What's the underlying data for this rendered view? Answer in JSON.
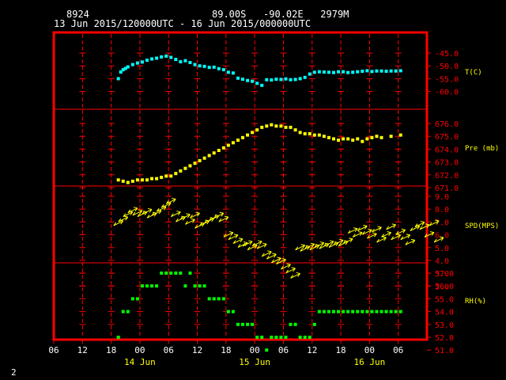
{
  "header": {
    "station": "8924",
    "location": "89.00S   -90.02E   2979M",
    "time_range": "13 Jun 2015/120000UTC - 16 Jun 2015/000000UTC"
  },
  "corner_label": "2",
  "colors": {
    "frame": "#ff0000",
    "grid": "#ff0000",
    "tick_label": "#ff0000",
    "axis_label": "#ffff00",
    "temperature": "#00ffff",
    "pressure": "#ffff00",
    "wind": "#ffff00",
    "rh": "#00ff00"
  },
  "chart_data": {
    "type": "scatter",
    "x_axis": {
      "hour_labels": [
        "06",
        "12",
        "18",
        "00",
        "06",
        "12",
        "18",
        "00",
        "06",
        "12",
        "18",
        "00",
        "06"
      ],
      "day_labels": [
        "14 Jun",
        "15 Jun",
        "16 Jun"
      ]
    },
    "panels": [
      {
        "name": "temperature",
        "label": "T(C)",
        "ticks": [
          "-45.0",
          "-50.0",
          "-55.0",
          "-60.0"
        ],
        "ylim": [
          -60,
          -45
        ],
        "unit_per_tick": 5,
        "points": [
          [
            13.5,
            -55.0
          ],
          [
            14.0,
            -52.4
          ],
          [
            14.5,
            -51.5
          ],
          [
            15.0,
            -51.0
          ],
          [
            15.5,
            -50.4
          ],
          [
            16.5,
            -49.5
          ],
          [
            17.5,
            -48.9
          ],
          [
            18.5,
            -48.5
          ],
          [
            19.5,
            -47.8
          ],
          [
            20.5,
            -47.3
          ],
          [
            21.5,
            -47.0
          ],
          [
            22.5,
            -46.5
          ],
          [
            23.5,
            -46.2
          ],
          [
            24.5,
            -46.7
          ],
          [
            25.5,
            -47.5
          ],
          [
            26.5,
            -48.4
          ],
          [
            27.5,
            -48.0
          ],
          [
            28.5,
            -48.7
          ],
          [
            29.5,
            -49.5
          ],
          [
            30.5,
            -50.0
          ],
          [
            31.5,
            -50.2
          ],
          [
            32.5,
            -50.6
          ],
          [
            33.5,
            -50.5
          ],
          [
            34.5,
            -51.1
          ],
          [
            35.5,
            -51.5
          ],
          [
            36.5,
            -52.5
          ],
          [
            37.5,
            -52.8
          ],
          [
            38.5,
            -54.8
          ],
          [
            39.5,
            -55.2
          ],
          [
            40.5,
            -55.7
          ],
          [
            41.5,
            -56.0
          ],
          [
            42.5,
            -56.8
          ],
          [
            43.5,
            -57.6
          ],
          [
            44.5,
            -55.4
          ],
          [
            45.5,
            -55.5
          ],
          [
            46.5,
            -55.2
          ],
          [
            47.5,
            -55.3
          ],
          [
            48.5,
            -55.1
          ],
          [
            49.5,
            -55.4
          ],
          [
            50.5,
            -55.3
          ],
          [
            51.5,
            -55.0
          ],
          [
            52.5,
            -54.5
          ],
          [
            53.5,
            -53.2
          ],
          [
            54.5,
            -52.5
          ],
          [
            55.5,
            -52.3
          ],
          [
            56.5,
            -52.4
          ],
          [
            57.5,
            -52.5
          ],
          [
            58.5,
            -52.6
          ],
          [
            59.5,
            -52.3
          ],
          [
            60.5,
            -52.3
          ],
          [
            61.5,
            -52.6
          ],
          [
            62.5,
            -52.5
          ],
          [
            63.5,
            -52.3
          ],
          [
            64.5,
            -52.1
          ],
          [
            65.5,
            -51.9
          ],
          [
            66.5,
            -52.2
          ],
          [
            67.5,
            -52.0
          ],
          [
            68.5,
            -52.0
          ],
          [
            69.5,
            -52.1
          ],
          [
            70.5,
            -52.0
          ],
          [
            71.5,
            -52.0
          ],
          [
            72.5,
            -51.9
          ]
        ]
      },
      {
        "name": "pressure",
        "label": "Pre (mb)",
        "ticks": [
          "676.0",
          "675.0",
          "674.0",
          "673.0",
          "672.0",
          "671.0"
        ],
        "ylim": [
          671,
          676
        ],
        "unit_per_tick": 1,
        "points": [
          [
            13.5,
            671.6
          ],
          [
            14.5,
            671.5
          ],
          [
            15.5,
            671.4
          ],
          [
            16.5,
            671.5
          ],
          [
            17.5,
            671.6
          ],
          [
            18.5,
            671.6
          ],
          [
            19.5,
            671.6
          ],
          [
            20.5,
            671.7
          ],
          [
            21.5,
            671.7
          ],
          [
            22.5,
            671.8
          ],
          [
            23.5,
            671.9
          ],
          [
            24.5,
            671.9
          ],
          [
            25.5,
            672.1
          ],
          [
            26.5,
            672.3
          ],
          [
            27.5,
            672.5
          ],
          [
            28.5,
            672.7
          ],
          [
            29.5,
            672.9
          ],
          [
            30.5,
            673.1
          ],
          [
            31.5,
            673.3
          ],
          [
            32.5,
            673.5
          ],
          [
            33.5,
            673.7
          ],
          [
            34.5,
            673.9
          ],
          [
            35.5,
            674.1
          ],
          [
            36.5,
            674.3
          ],
          [
            37.5,
            674.5
          ],
          [
            38.5,
            674.7
          ],
          [
            39.5,
            674.9
          ],
          [
            40.5,
            675.1
          ],
          [
            41.5,
            675.3
          ],
          [
            42.5,
            675.5
          ],
          [
            43.5,
            675.7
          ],
          [
            44.5,
            675.8
          ],
          [
            45.5,
            675.9
          ],
          [
            46.5,
            675.8
          ],
          [
            47.5,
            675.8
          ],
          [
            48.5,
            675.7
          ],
          [
            49.5,
            675.7
          ],
          [
            50.5,
            675.5
          ],
          [
            51.5,
            675.3
          ],
          [
            52.5,
            675.2
          ],
          [
            53.5,
            675.2
          ],
          [
            54.5,
            675.1
          ],
          [
            55.5,
            675.1
          ],
          [
            56.5,
            675.0
          ],
          [
            57.5,
            674.9
          ],
          [
            58.5,
            674.8
          ],
          [
            59.5,
            674.7
          ],
          [
            60.5,
            674.8
          ],
          [
            61.5,
            674.8
          ],
          [
            62.5,
            674.7
          ],
          [
            63.5,
            674.8
          ],
          [
            64.5,
            674.6
          ],
          [
            65.5,
            674.8
          ],
          [
            66.5,
            674.9
          ],
          [
            67.5,
            675.0
          ],
          [
            68.5,
            674.9
          ],
          [
            70.5,
            675.0
          ],
          [
            72.5,
            675.1
          ]
        ]
      },
      {
        "name": "wind",
        "label": "SPD(MPS)",
        "ticks": [
          "9.0",
          "8.0",
          "7.0",
          "6.0",
          "5.0",
          "4.0",
          "3.0",
          "2.0"
        ],
        "ylim": [
          2,
          9
        ],
        "unit_per_tick": 1,
        "points": [
          [
            13.5,
            6.9
          ],
          [
            14.5,
            7.2
          ],
          [
            15.5,
            7.6
          ],
          [
            16.5,
            7.9
          ],
          [
            17.5,
            7.7
          ],
          [
            18.5,
            7.6
          ],
          [
            19.5,
            7.8
          ],
          [
            20.5,
            7.5
          ],
          [
            21.5,
            7.7
          ],
          [
            22.5,
            8.0
          ],
          [
            23.5,
            8.3
          ],
          [
            24.5,
            8.6
          ],
          [
            25.5,
            7.6
          ],
          [
            26.5,
            7.2
          ],
          [
            27.5,
            7.4
          ],
          [
            28.5,
            7.0
          ],
          [
            29.5,
            7.5
          ],
          [
            30.5,
            6.7
          ],
          [
            31.5,
            6.9
          ],
          [
            32.5,
            7.1
          ],
          [
            33.5,
            7.3
          ],
          [
            34.5,
            7.5
          ],
          [
            35.5,
            7.2
          ],
          [
            36.5,
            6.0
          ],
          [
            37.5,
            5.8
          ],
          [
            38.5,
            5.5
          ],
          [
            39.5,
            5.2
          ],
          [
            40.5,
            5.3
          ],
          [
            41.5,
            5.0
          ],
          [
            42.5,
            5.3
          ],
          [
            43.5,
            5.1
          ],
          [
            44.5,
            4.5
          ],
          [
            45.5,
            4.3
          ],
          [
            46.5,
            4.0
          ],
          [
            47.5,
            3.9
          ],
          [
            48.5,
            3.5
          ],
          [
            49.5,
            3.2
          ],
          [
            50.5,
            2.8
          ],
          [
            51.5,
            5.0
          ],
          [
            52.5,
            4.9
          ],
          [
            53.5,
            5.1
          ],
          [
            54.5,
            5.0
          ],
          [
            55.5,
            5.2
          ],
          [
            56.5,
            5.1
          ],
          [
            57.5,
            5.3
          ],
          [
            58.5,
            5.2
          ],
          [
            59.5,
            5.4
          ],
          [
            60.5,
            5.3
          ],
          [
            61.5,
            5.5
          ],
          [
            62.5,
            6.3
          ],
          [
            63.5,
            6.0
          ],
          [
            64.5,
            6.5
          ],
          [
            65.5,
            6.2
          ],
          [
            66.5,
            5.9
          ],
          [
            67.5,
            6.4
          ],
          [
            68.5,
            5.6
          ],
          [
            69.5,
            6.0
          ],
          [
            70.5,
            6.6
          ],
          [
            71.5,
            5.8
          ],
          [
            72.5,
            6.2
          ],
          [
            73.5,
            5.8
          ],
          [
            74.5,
            5.4
          ],
          [
            75.5,
            6.5
          ],
          [
            76.5,
            6.8
          ],
          [
            77.5,
            6.6
          ],
          [
            78.5,
            6.0
          ],
          [
            79.5,
            6.9
          ],
          [
            80.5,
            5.6
          ]
        ]
      },
      {
        "name": "rh",
        "label": "RH(%)",
        "ticks": [
          "57.0",
          "56.0",
          "55.0",
          "54.0",
          "53.0",
          "52.0",
          "51.0"
        ],
        "ylim": [
          51,
          57
        ],
        "unit_per_tick": 1,
        "points": [
          [
            13.5,
            52.0
          ],
          [
            14.5,
            54.0
          ],
          [
            15.5,
            54.0
          ],
          [
            16.5,
            55.0
          ],
          [
            17.5,
            55.0
          ],
          [
            18.5,
            56.0
          ],
          [
            19.5,
            56.0
          ],
          [
            20.5,
            56.0
          ],
          [
            21.5,
            56.0
          ],
          [
            22.5,
            57.0
          ],
          [
            23.5,
            57.0
          ],
          [
            24.5,
            57.0
          ],
          [
            25.5,
            57.0
          ],
          [
            26.5,
            57.0
          ],
          [
            27.5,
            56.0
          ],
          [
            28.5,
            57.0
          ],
          [
            29.5,
            56.0
          ],
          [
            30.5,
            56.0
          ],
          [
            31.5,
            56.0
          ],
          [
            32.5,
            55.0
          ],
          [
            33.5,
            55.0
          ],
          [
            34.5,
            55.0
          ],
          [
            35.5,
            55.0
          ],
          [
            36.5,
            54.0
          ],
          [
            37.5,
            54.0
          ],
          [
            38.5,
            53.0
          ],
          [
            39.5,
            53.0
          ],
          [
            40.5,
            53.0
          ],
          [
            41.5,
            53.0
          ],
          [
            42.5,
            52.0
          ],
          [
            43.5,
            52.0
          ],
          [
            44.5,
            51.0
          ],
          [
            45.5,
            52.0
          ],
          [
            46.5,
            52.0
          ],
          [
            47.5,
            52.0
          ],
          [
            48.5,
            52.0
          ],
          [
            49.5,
            53.0
          ],
          [
            50.5,
            53.0
          ],
          [
            51.5,
            52.0
          ],
          [
            52.5,
            52.0
          ],
          [
            53.5,
            52.0
          ],
          [
            54.5,
            53.0
          ],
          [
            55.5,
            54.0
          ],
          [
            56.5,
            54.0
          ],
          [
            57.5,
            54.0
          ],
          [
            58.5,
            54.0
          ],
          [
            59.5,
            54.0
          ],
          [
            60.5,
            54.0
          ],
          [
            61.5,
            54.0
          ],
          [
            62.5,
            54.0
          ],
          [
            63.5,
            54.0
          ],
          [
            64.5,
            54.0
          ],
          [
            65.5,
            54.0
          ],
          [
            66.5,
            54.0
          ],
          [
            67.5,
            54.0
          ],
          [
            68.5,
            54.0
          ],
          [
            69.5,
            54.0
          ],
          [
            70.5,
            54.0
          ],
          [
            71.5,
            54.0
          ],
          [
            72.5,
            54.0
          ]
        ]
      }
    ]
  }
}
